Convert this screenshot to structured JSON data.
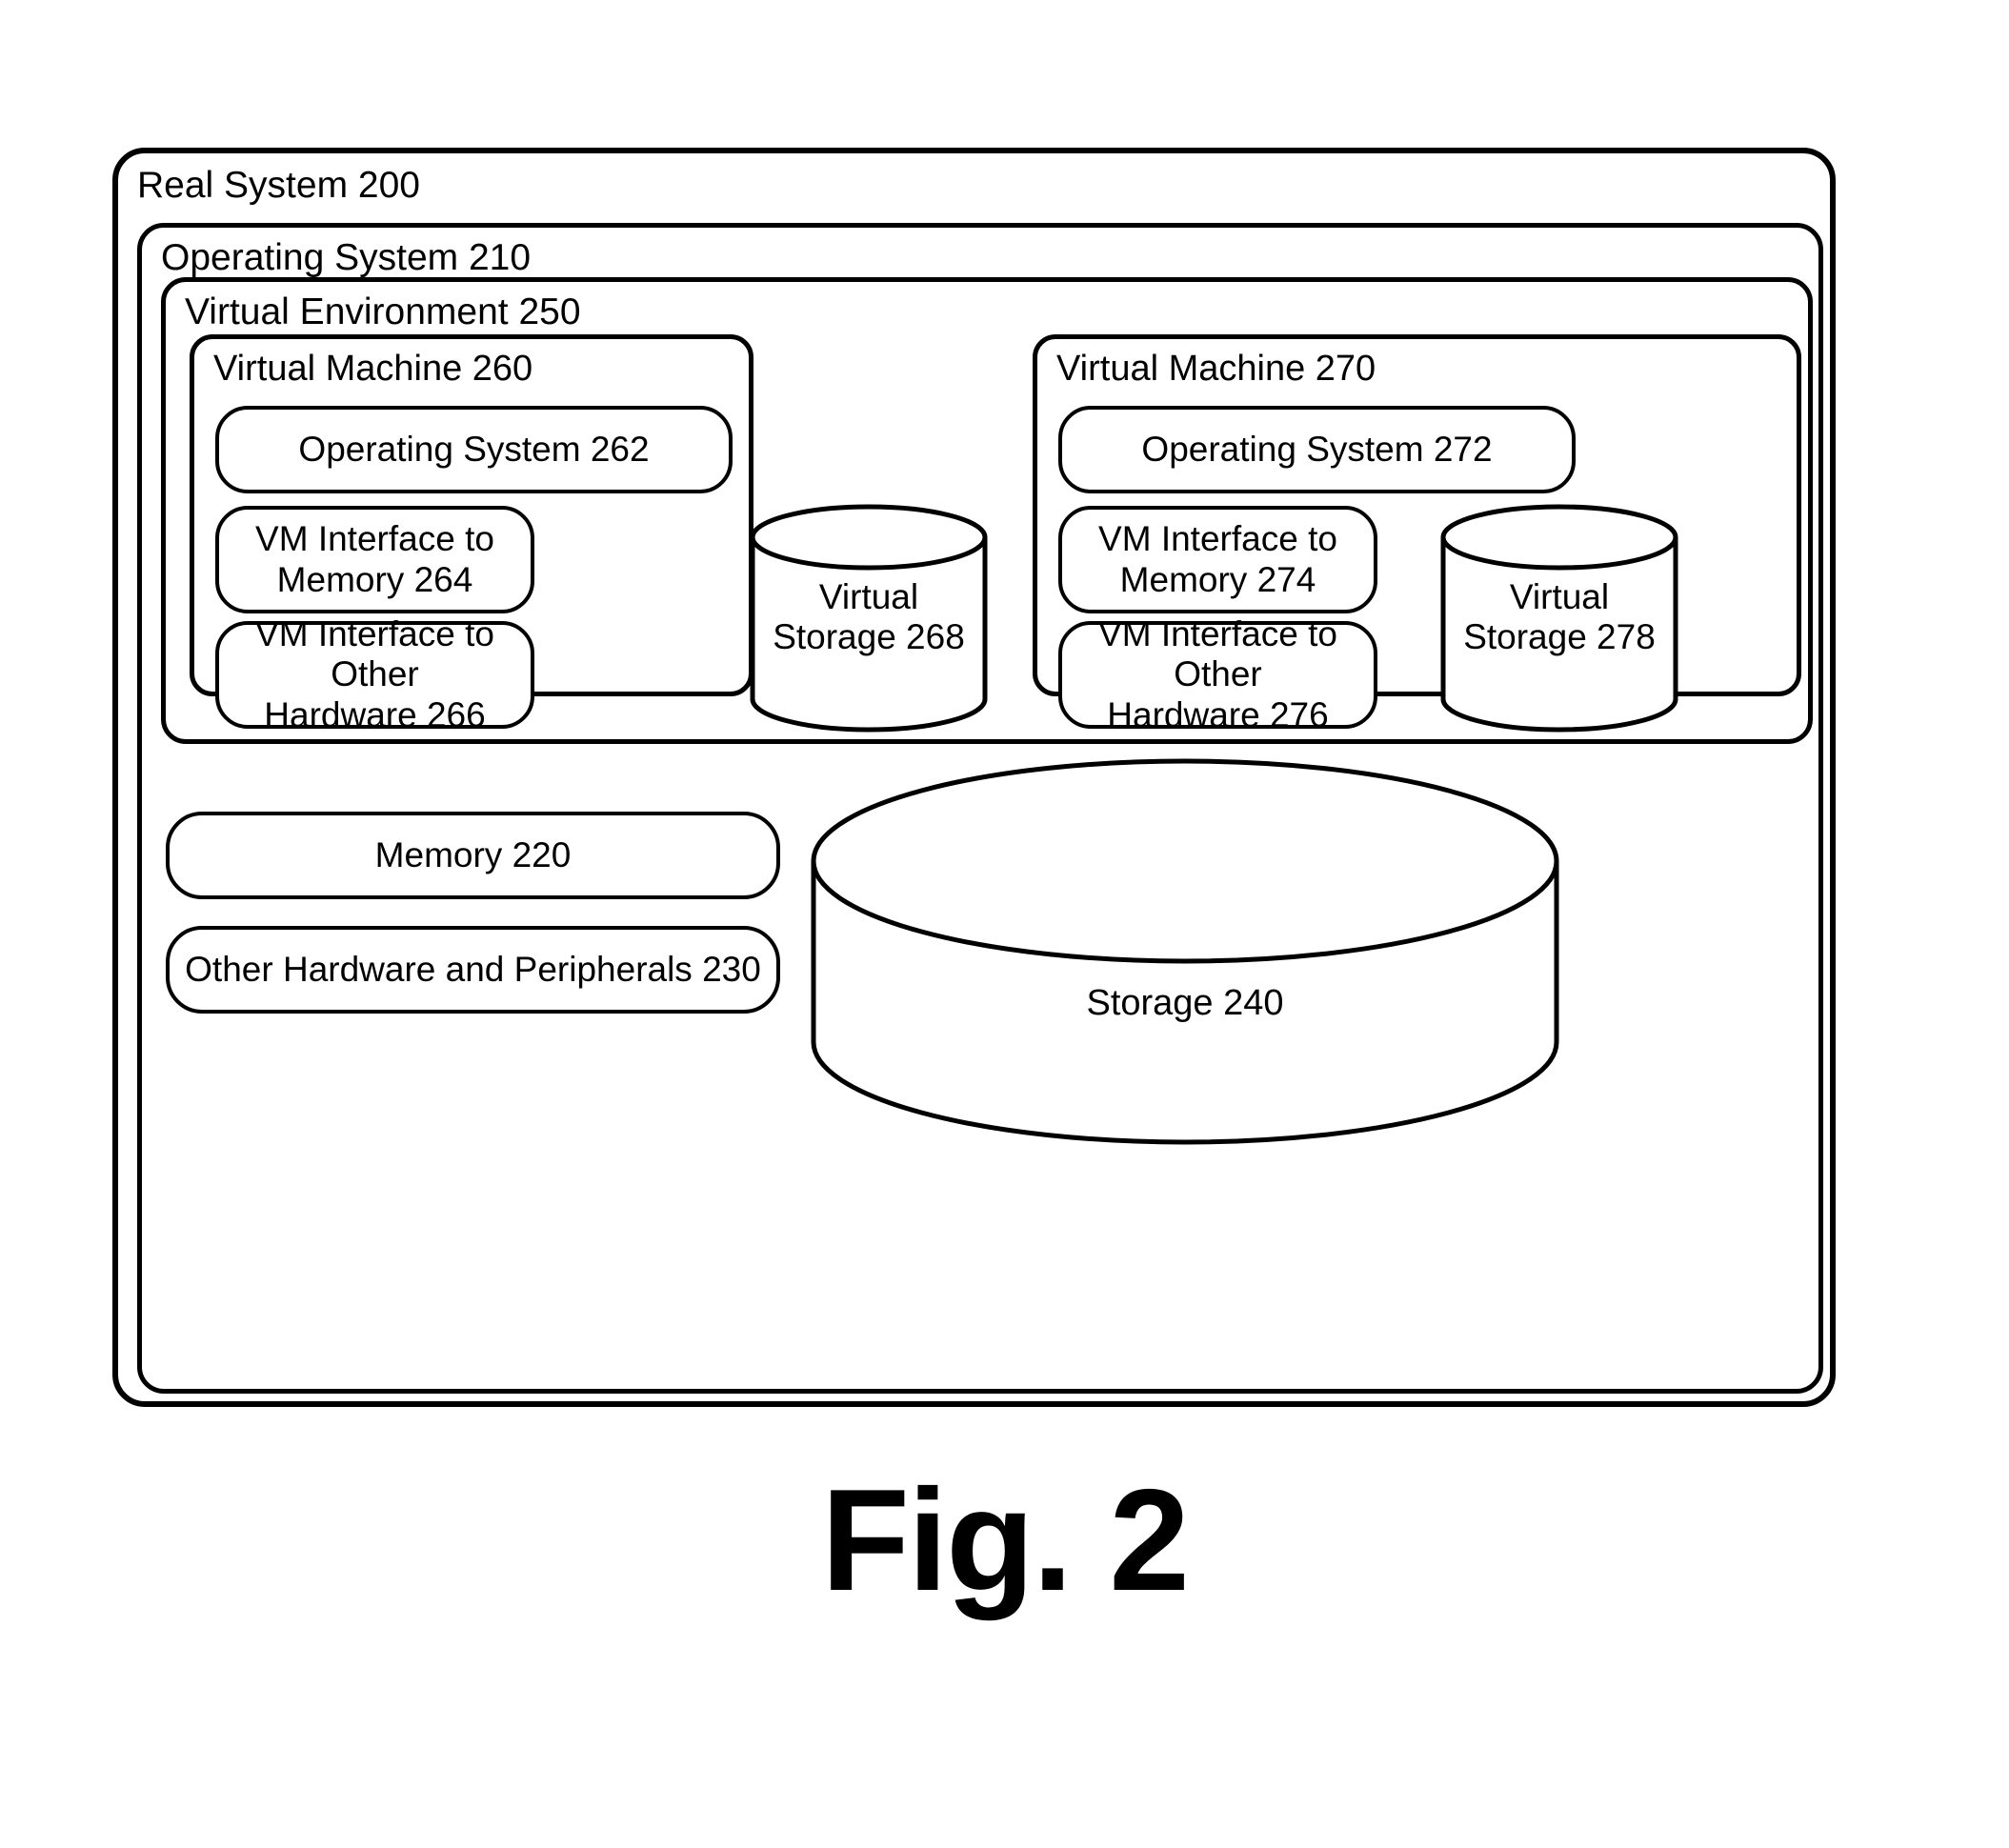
{
  "figure": {
    "caption": "Fig. 2"
  },
  "real_system": {
    "title": "Real System 200",
    "operating_system": {
      "title": "Operating System 210",
      "virtual_environment": {
        "title": "Virtual Environment 250",
        "virtual_machines": [
          {
            "title": "Virtual Machine 260",
            "os": "Operating System 262",
            "interface_memory": "VM Interface to\nMemory 264",
            "interface_other_hardware": "VM Interface to Other\nHardware 266",
            "virtual_storage": "Virtual\nStorage 268"
          },
          {
            "title": "Virtual Machine 270",
            "os": "Operating System 272",
            "interface_memory": "VM Interface to\nMemory 274",
            "interface_other_hardware": "VM Interface to Other\nHardware 276",
            "virtual_storage": "Virtual\nStorage 278"
          }
        ]
      },
      "memory": "Memory 220",
      "other_hardware": "Other Hardware and Peripherals 230",
      "storage": "Storage 240"
    }
  },
  "style": {
    "stroke": "#000000",
    "background": "#ffffff"
  }
}
